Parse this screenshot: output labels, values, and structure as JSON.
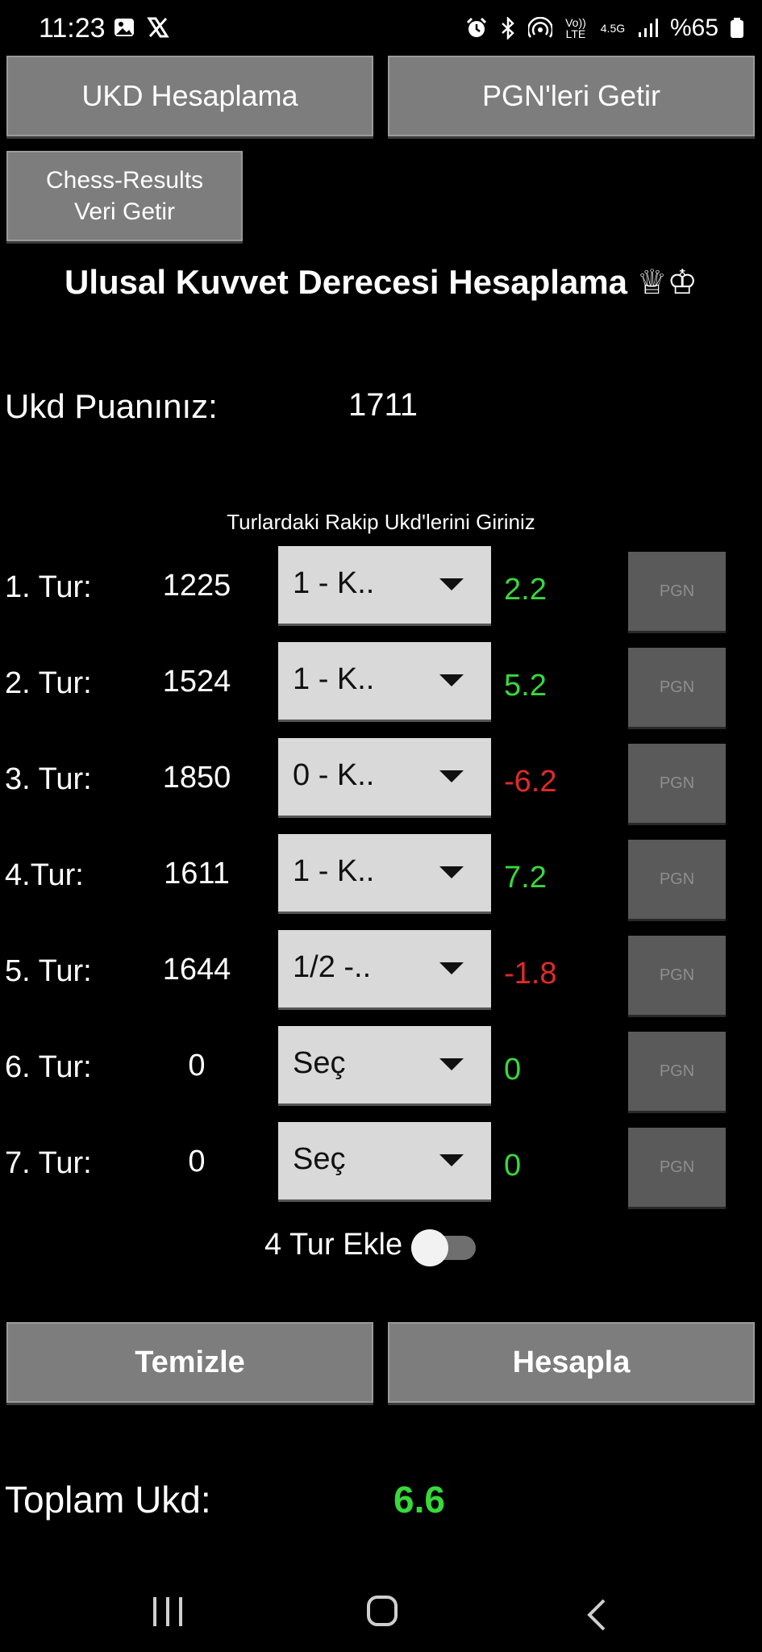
{
  "status_bar": {
    "time": "11:23",
    "network_top": "Vo)) LTE",
    "network_4g": "4.5G",
    "battery_percent": "%65"
  },
  "buttons": {
    "ukd_hesaplama": "UKD Hesaplama",
    "pgn_getir": "PGN'leri Getir",
    "chess_results_line1": "Chess-Results",
    "chess_results_line2": "Veri Getir",
    "temizle": "Temizle",
    "hesapla": "Hesapla"
  },
  "title": "Ulusal Kuvvet Derecesi Hesaplama ♕♔",
  "ukd": {
    "label": "Ukd Puanınız:",
    "value": "1711"
  },
  "rounds_hint": "Turlardaki Rakip Ukd'lerini Giriniz",
  "rounds": [
    {
      "label": "1. Tur:",
      "opponent": "1225",
      "result": "1 - K..",
      "delta": "2.2",
      "pgn": "PGN"
    },
    {
      "label": "2. Tur:",
      "opponent": "1524",
      "result": "1 - K..",
      "delta": "5.2",
      "pgn": "PGN"
    },
    {
      "label": "3. Tur:",
      "opponent": "1850",
      "result": "0 - K..",
      "delta": "-6.2",
      "pgn": "PGN"
    },
    {
      "label": "4.Tur:",
      "opponent": "1611",
      "result": "1 - K..",
      "delta": "7.2",
      "pgn": "PGN"
    },
    {
      "label": "5. Tur:",
      "opponent": "1644",
      "result": "1/2 -..",
      "delta": "-1.8",
      "pgn": "PGN"
    },
    {
      "label": "6. Tur:",
      "opponent": "0",
      "result": "Seç",
      "delta": "0",
      "pgn": "PGN"
    },
    {
      "label": "7. Tur:",
      "opponent": "0",
      "result": "Seç",
      "delta": "0",
      "pgn": "PGN"
    }
  ],
  "toggle": {
    "label": "4 Tur Ekle",
    "on": false
  },
  "total": {
    "label": "Toplam Ukd:",
    "value": "6.6"
  },
  "colors": {
    "positive": "#37d93a",
    "negative": "#e02a2a",
    "button": "#7d7d7d"
  }
}
